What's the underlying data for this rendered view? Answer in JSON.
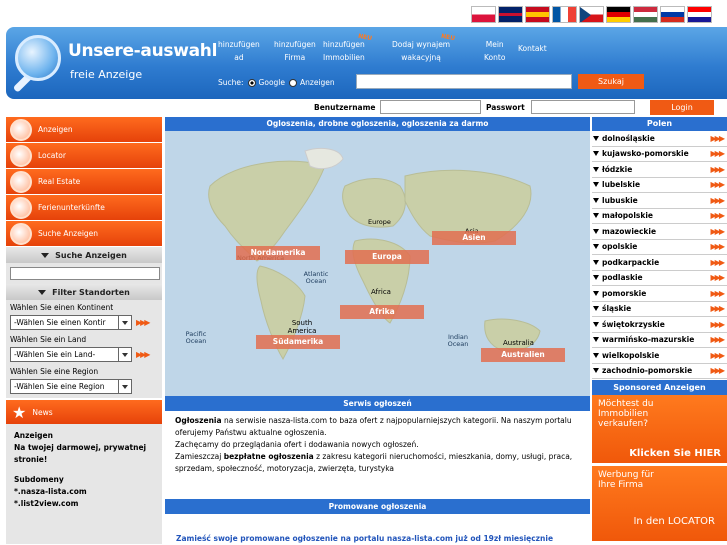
{
  "flags": [
    {
      "name": "polish-flag-icon",
      "colors": [
        "#ffffff",
        "#dc143c"
      ]
    },
    {
      "name": "uk-flag-icon",
      "colors": [
        "#012169",
        "#ffffff",
        "#c8102e"
      ]
    },
    {
      "name": "spanish-flag-icon",
      "colors": [
        "#c60b1e",
        "#ffc400",
        "#c60b1e"
      ]
    },
    {
      "name": "french-flag-icon",
      "colors": [
        "#0055a4",
        "#ffffff",
        "#ef4135"
      ]
    },
    {
      "name": "czech-flag-icon",
      "colors": [
        "#ffffff",
        "#d7141a",
        "#11457e"
      ]
    },
    {
      "name": "german-flag-icon",
      "colors": [
        "#000000",
        "#dd0000",
        "#ffce00"
      ]
    },
    {
      "name": "hungarian-flag-icon",
      "colors": [
        "#cd2a3e",
        "#ffffff",
        "#436f4d"
      ]
    },
    {
      "name": "russian-flag-icon",
      "colors": [
        "#ffffff",
        "#0039a6",
        "#d52b1e"
      ]
    },
    {
      "name": "croatian-flag-icon",
      "colors": [
        "#ff0000",
        "#ffffff",
        "#171796"
      ]
    }
  ],
  "header": {
    "logo_title": "Unsere-auswahl",
    "logo_subtitle": "freie Anzeige",
    "nav": [
      {
        "line1": "hinzufügen",
        "line2": "ad",
        "badge": ""
      },
      {
        "line1": "hinzufügen",
        "line2": "Firma",
        "badge": ""
      },
      {
        "line1": "hinzufügen",
        "line2": "Immobilien",
        "badge": "NEU"
      },
      {
        "line1": "Dodaj wynajem",
        "line2": "wakacyjną",
        "badge": "NEU"
      },
      {
        "line1": "Mein",
        "line2": "Konto",
        "badge": ""
      },
      {
        "line1": "Kontakt",
        "line2": "",
        "badge": ""
      }
    ],
    "search_label": "Suche:",
    "radio_google": "Google",
    "radio_anzeigen": "Anzeigen",
    "search_value": "",
    "search_button": "Szukaj"
  },
  "login": {
    "user_label": "Benutzername",
    "pass_label": "Passwort",
    "button": "Login"
  },
  "left_menu": [
    "Anzeigen",
    "Locator",
    "Real Estate",
    "Ferienunterkünfte",
    "Suche Anzeigen"
  ],
  "search_ads": {
    "title": "Suche Anzeigen",
    "value": ""
  },
  "filter": {
    "title": "Filter Standorten",
    "continent_label": "Wählen Sie einen Kontinent",
    "continent_value": "-Wählen Sie einen Kontir",
    "country_label": "Wählen Sie ein Land",
    "country_value": "-Wählen Sie ein Land-",
    "region_label": "Wählen Sie eine Region",
    "region_value": "-Wählen Sie eine Region"
  },
  "news": {
    "title": "News",
    "line1": "Anzeigen",
    "line2": "Na twojej darmowej, prywatnej stronie!",
    "line3": "Subdomeny",
    "line4": "*.nasza-lista.com",
    "line5": "*.list2view.com"
  },
  "map": {
    "header": "Ogloszenia, drobne ogloszenia, ogloszenia za darmo",
    "regions": [
      "Nordamerika",
      "Europa",
      "Asien",
      "Afrika",
      "Südamerika",
      "Australien"
    ],
    "labels": {
      "north_america": "North America",
      "europe": "Europe",
      "asia": "Asia",
      "africa": "Africa",
      "south_america": "South America",
      "australia": "Australia",
      "atlantic": "Atlantic Ocean",
      "pacific": "Pacific Ocean",
      "indian": "Indian Ocean"
    }
  },
  "serwis": {
    "header": "Serwis ogłoszeń",
    "p1_bold": "Ogłoszenia",
    "p1_rest": " na serwisie nasza-lista.com to baza ofert z najpopularniejszych kategorii. Na naszym portalu oferujemy Państwu aktualne ogłoszenia.",
    "p2": "Zachęcamy do przeglądania ofert i dodawania nowych ogłoszeń.",
    "p3_a": "Zamieszczaj ",
    "p3_bold": "bezpłatne ogłoszenia",
    "p3_rest": " z zakresu kategorii nieruchomości, mieszkania, domy, usługi, praca, sprzedam, społeczność, motoryzacja, zwierzęta, turystyka"
  },
  "promo": {
    "header": "Promowane ogłoszenia",
    "text": "Zamieść swoje promowane ogłoszenie na portalu nasza-lista.com już od 19zł miesięcznie"
  },
  "polen": {
    "title": "Polen",
    "items": [
      "dolnośląskie",
      "kujawsko-pomorskie",
      "łódzkie",
      "lubelskie",
      "lubuskie",
      "małopolskie",
      "mazowieckie",
      "opolskie",
      "podkarpackie",
      "podlaskie",
      "pomorskie",
      "śląskie",
      "świętokrzyskie",
      "warmińsko-mazurskie",
      "wielkopolskie",
      "zachodnio-pomorskie"
    ]
  },
  "sponsored": {
    "title": "Sponsored Anzeigen",
    "ad1_line1": "Möchtest du",
    "ad1_line2": "Immobilien",
    "ad1_line3": "verkaufen?",
    "ad1_cta": "Klicken Sie HIER",
    "ad2_line1": "Werbung für",
    "ad2_line2": "Ihre Firma",
    "ad2_cta": "In den LOCATOR"
  },
  "colors": {
    "accent": "#f05a14",
    "header_blue": "#2f7cd0",
    "bar_blue": "#2a6fcf"
  }
}
